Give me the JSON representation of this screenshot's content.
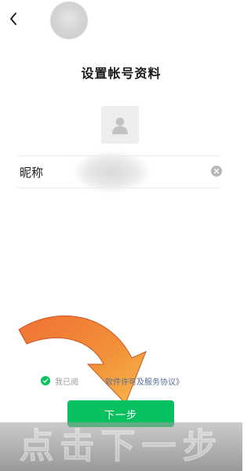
{
  "header": {
    "back_icon": "chevron-left-icon"
  },
  "page": {
    "title": "设置帐号资料"
  },
  "avatar": {
    "icon": "person-silhouette-icon"
  },
  "nickname": {
    "label": "昵称",
    "value": "",
    "clear_icon": "clear-circle-icon"
  },
  "agreement": {
    "prefix": "我已阅",
    "link": "软件许可及服务协议》",
    "checked": true
  },
  "next_button": {
    "label": "下一步"
  },
  "caption": {
    "text": "点击下一步"
  },
  "colors": {
    "accent_green": "#07c160",
    "link_blue": "#576b95",
    "arrow_orange": "#e8622a"
  }
}
